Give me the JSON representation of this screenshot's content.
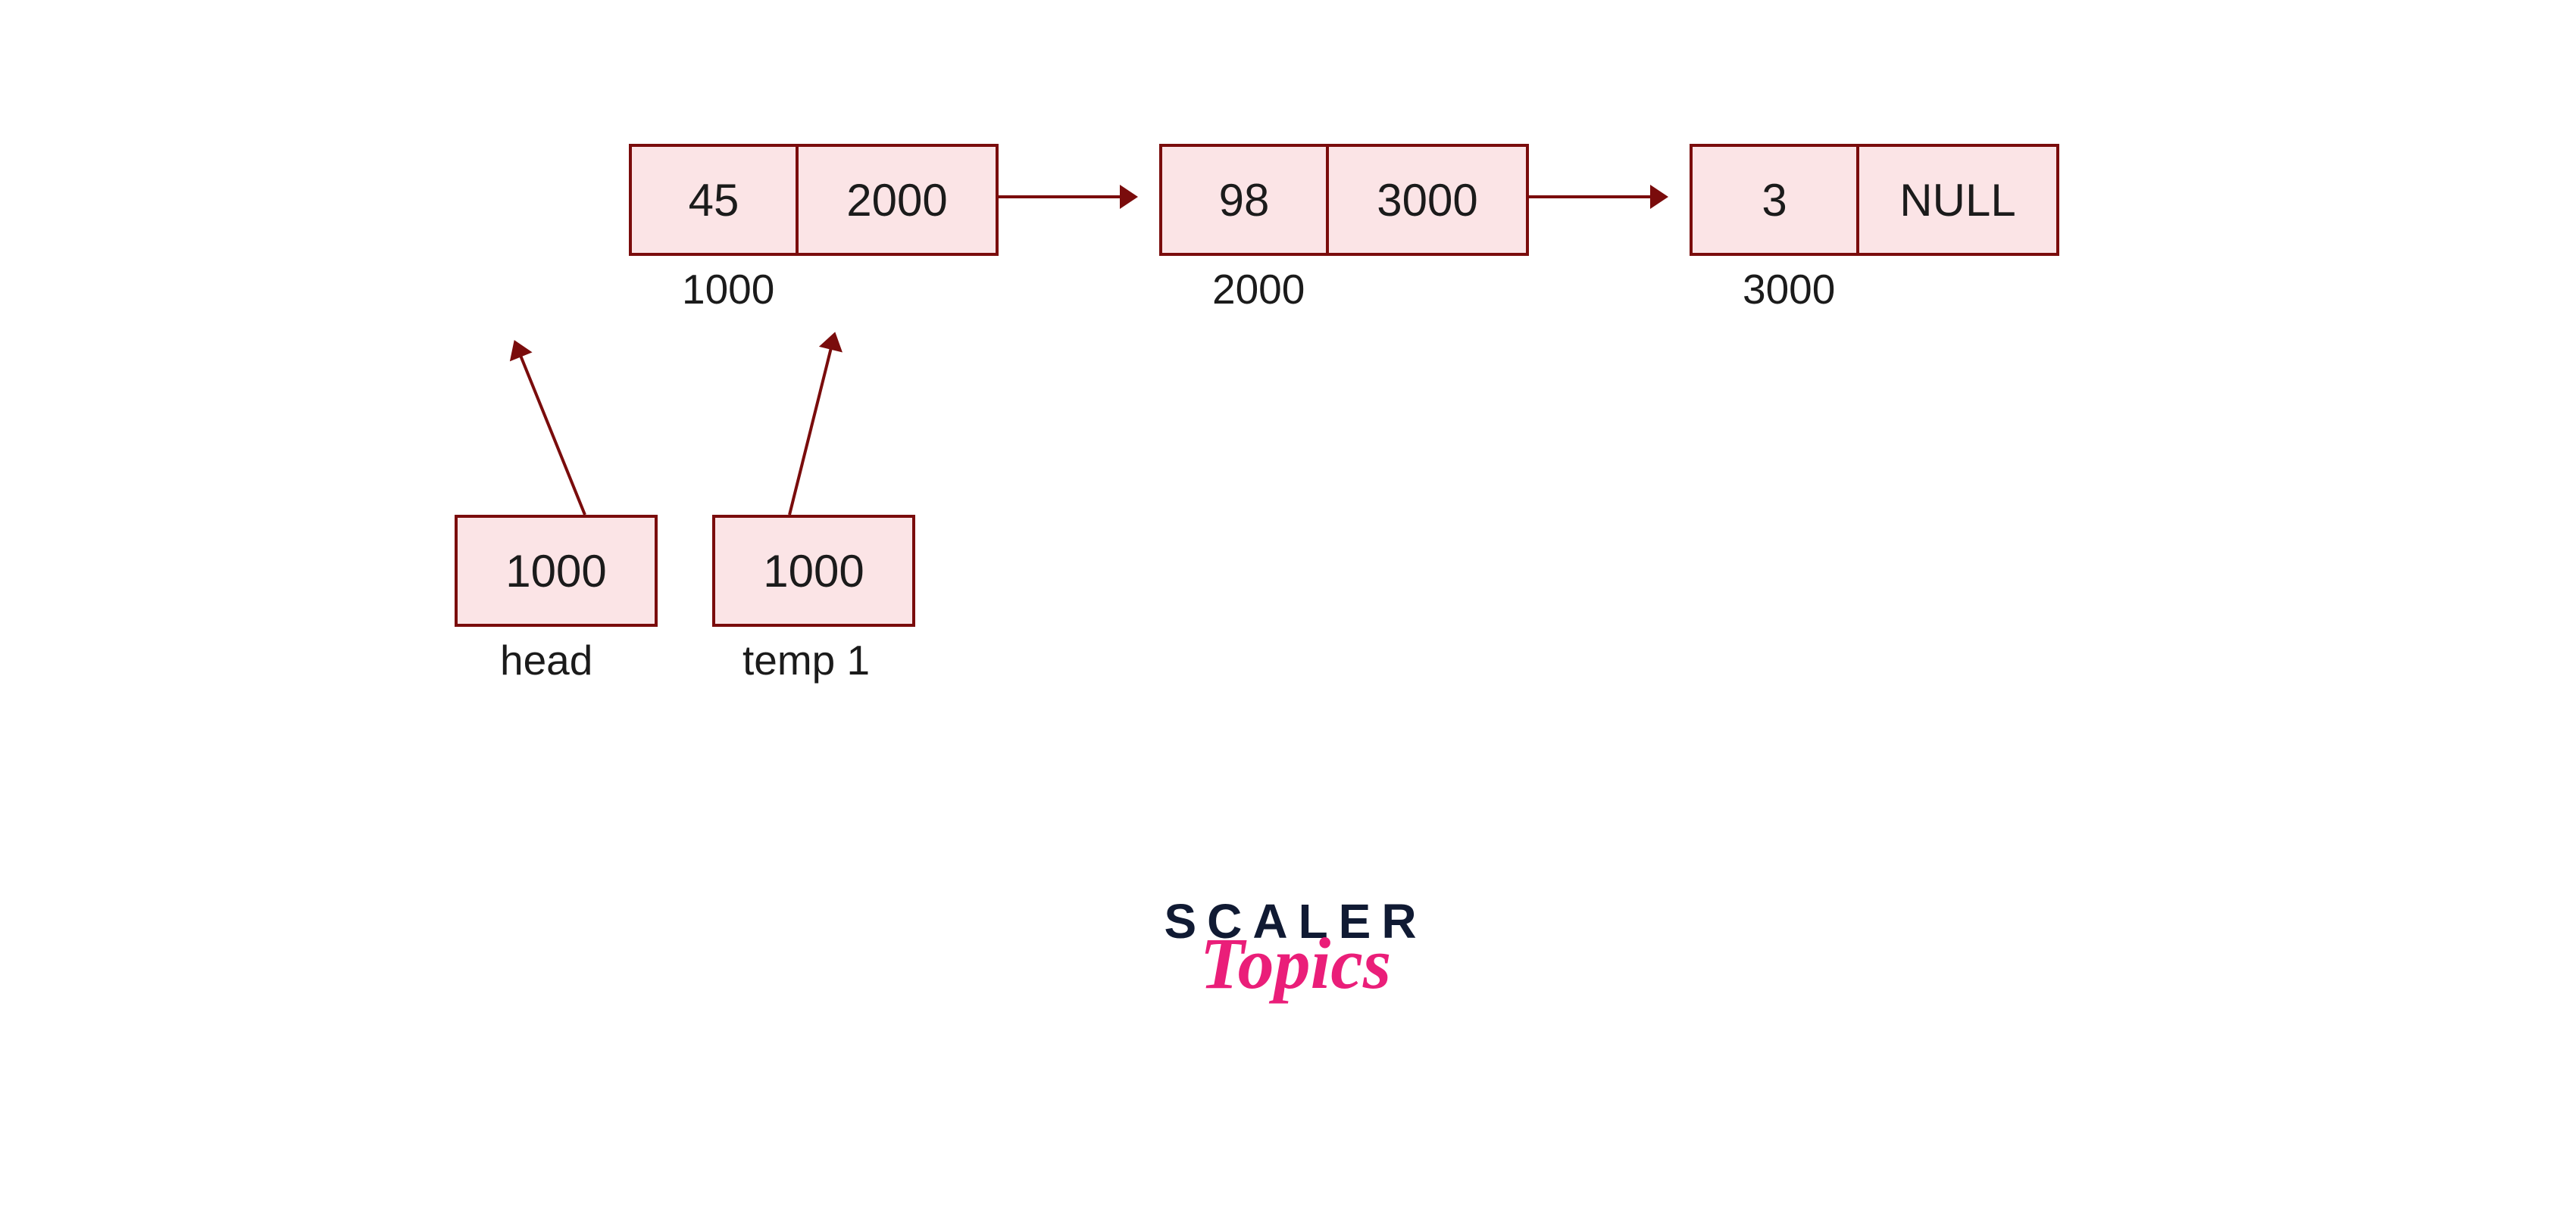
{
  "nodes": [
    {
      "data": "45",
      "next": "2000",
      "addr": "1000"
    },
    {
      "data": "98",
      "next": "3000",
      "addr": "2000"
    },
    {
      "data": "3",
      "next": "NULL",
      "addr": "3000"
    }
  ],
  "pointers": {
    "head": {
      "value": "1000",
      "label": "head"
    },
    "temp1": {
      "value": "1000",
      "label": "temp 1"
    }
  },
  "logo": {
    "line1": "SCALER",
    "line2": "Topics"
  },
  "colors": {
    "stroke": "#7a0c0c",
    "fill": "#fbe4e6",
    "text": "#1b1b1b",
    "logo_dark": "#101a33",
    "logo_pink": "#ea1e79"
  }
}
